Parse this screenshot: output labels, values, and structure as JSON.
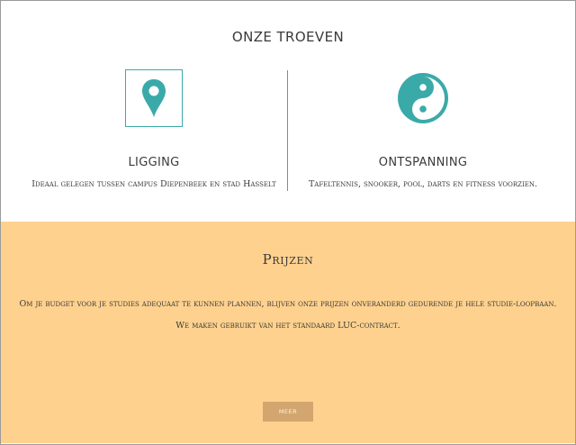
{
  "troeven": {
    "title": "ONZE TROEVEN",
    "features": [
      {
        "icon": "map-pin-icon",
        "title": "LIGGING",
        "text": "Ideaal gelegen tussen campus Diepenbeek en stad Hasselt"
      },
      {
        "icon": "yin-yang-icon",
        "title": "ONTSPANNING",
        "text": "Tafeltennis, snooker, pool, darts en fitness voorzien."
      }
    ]
  },
  "prijzen": {
    "title": "Prijzen",
    "text_1": "Om je budget voor je studies adequaat te kunnen plannen, blijven onze prijzen onveranderd gedurende je hele studie-loopbaan.",
    "text_2": "We maken gebruikt van het standaard LUC-contract.",
    "button_label": "MEER"
  },
  "colors": {
    "accent": "#3aaaa9",
    "prijzen_background": "#fed18e",
    "button_background": "#d2a66e"
  }
}
